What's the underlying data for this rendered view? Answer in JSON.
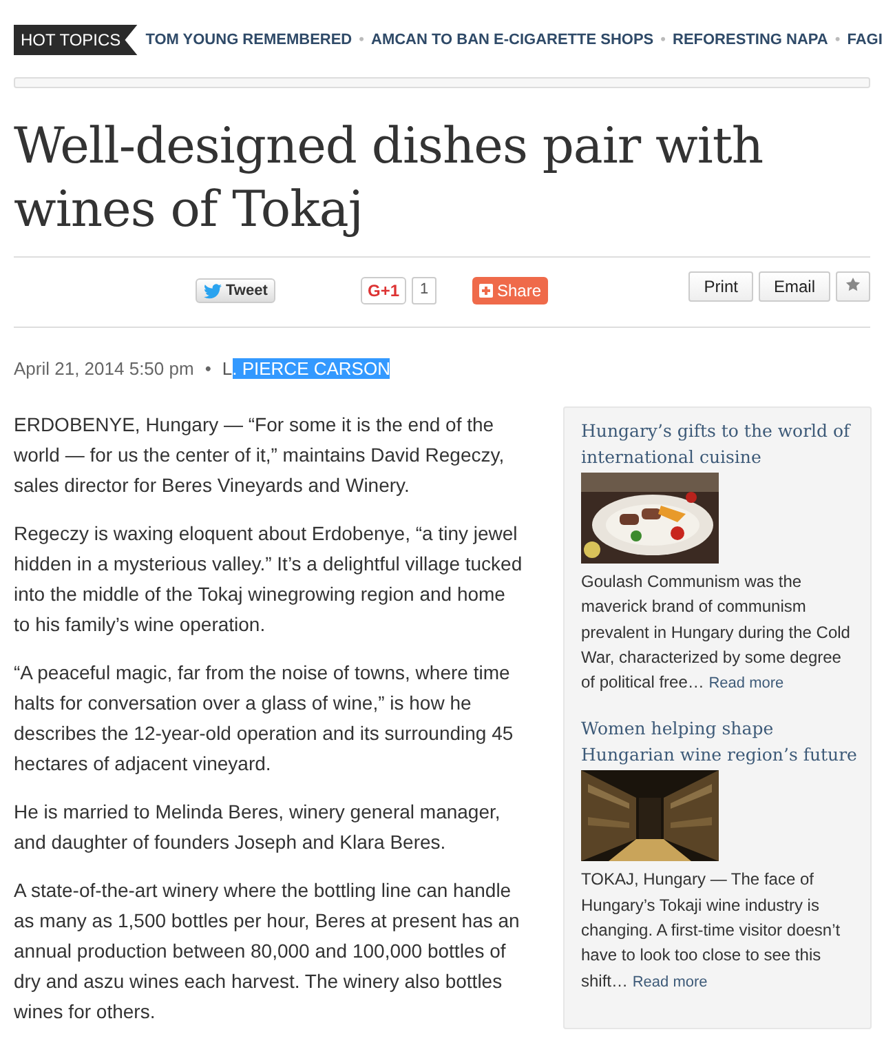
{
  "hot_topics": {
    "label": "HOT TOPICS",
    "separator": "•",
    "items": [
      "TOM YOUNG REMEMBERED",
      "AMCAN TO BAN E-CIGARETTE SHOPS",
      "REFORESTING NAPA",
      "FAGI"
    ]
  },
  "article": {
    "title": "Well-designed dishes pair with wines of Tokaj",
    "share": {
      "tweet": "Tweet",
      "gplus": "G+1",
      "gplus_count": "1",
      "share": "Share"
    },
    "tools": {
      "print": "Print",
      "email": "Email"
    },
    "date": "April 21, 2014 5:50 pm",
    "separator": "•",
    "author_parts": [
      {
        "text": "L",
        "selected": false
      },
      {
        "text": ". PIERCE CARSON",
        "selected": true
      }
    ],
    "paragraphs": [
      "ERDOBENYE, Hungary — “For some it is the end of the world — for us the center of it,” maintains David Regeczy, sales director for Beres Vineyards and Winery.",
      "Regeczy is waxing eloquent about Erdobenye, “a tiny jewel hidden in a mysterious valley.” It’s a delightful village tucked into the middle of the Tokaj winegrowing region and home to his family’s wine operation.",
      "“A peaceful magic, far from the noise of towns, where time halts for conversation over a glass of wine,” is how he describes the 12-year-old operation and its surrounding 45 hectares of adjacent vineyard.",
      "He is married to Melinda Beres, winery general manager, and daughter of founders Joseph and Klara Beres.",
      "A state-of-the-art winery where the bottling line can handle as many as 1,500 bottles per hour, Beres at present has an annual production between 80,000 and 100,000 bottles of dry and aszu wines each harvest. The winery also bottles wines for others."
    ]
  },
  "sidebar": {
    "stories": [
      {
        "title": "Hungary’s gifts to the world of international cuisine",
        "kind": "food",
        "excerpt": "Goulash Communism was the maverick brand of communism prevalent in Hungary during the Cold War, characterized by some degree of political free…",
        "link": "Read more"
      },
      {
        "title": "Women helping shape Hungarian wine region’s future",
        "kind": "cellar",
        "excerpt": "TOKAJ, Hungary — The face of Hungary’s Tokaji wine industry is changing. A first-time visitor doesn’t have to look too close to see this shift…",
        "link": "Read more"
      }
    ]
  }
}
